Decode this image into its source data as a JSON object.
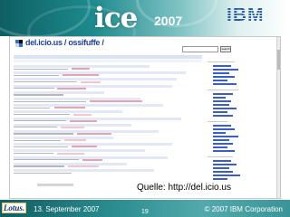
{
  "banner": {
    "ice_logo": "ice",
    "ice_year": "2007",
    "ibm_logo": "IBM"
  },
  "site": {
    "title": "del.icio.us / ossifuffe /",
    "search_button": "search"
  },
  "caption": "Quelle: http://del.icio.us",
  "footer": {
    "lotus_logo": "Lotus.",
    "date": "13. September 2007",
    "page": "19",
    "copyright": "© 2007 IBM Corporation"
  }
}
